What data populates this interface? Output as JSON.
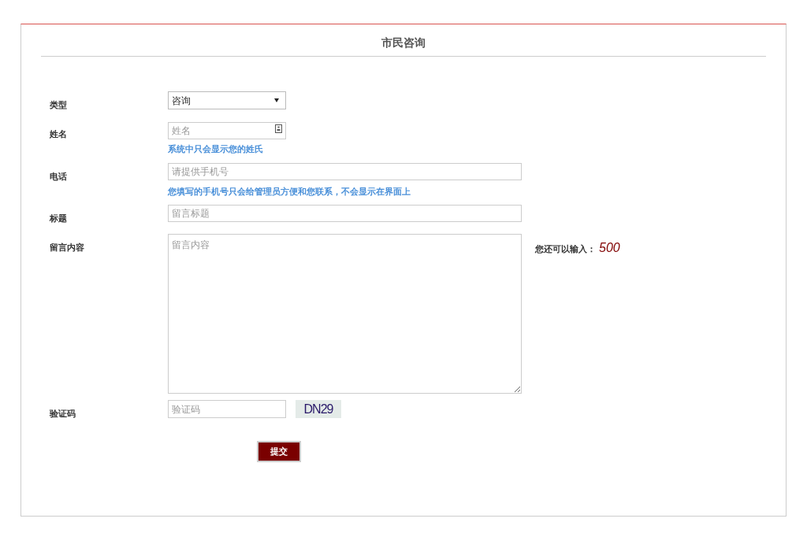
{
  "title": "市民咨询",
  "fields": [
    {
      "kind": "select",
      "label": "类型",
      "value": "咨询"
    },
    {
      "kind": "name",
      "label": "姓名",
      "placeholder": "姓名",
      "hint": "系统中只会显示您的姓氏"
    },
    {
      "kind": "text",
      "label": "电话",
      "placeholder": "请提供手机号",
      "hint": "您填写的手机号只会给管理员方便和您联系，不会显示在界面上"
    },
    {
      "kind": "text",
      "label": "标题",
      "placeholder": "留言标题"
    },
    {
      "kind": "textarea",
      "label": "留言内容",
      "placeholder": "留言内容",
      "counter_label": "您还可以输入：",
      "counter_value": "500"
    },
    {
      "kind": "captcha",
      "label": "验证码",
      "placeholder": "验证码",
      "captcha": "DN29"
    }
  ],
  "submit": "提交"
}
